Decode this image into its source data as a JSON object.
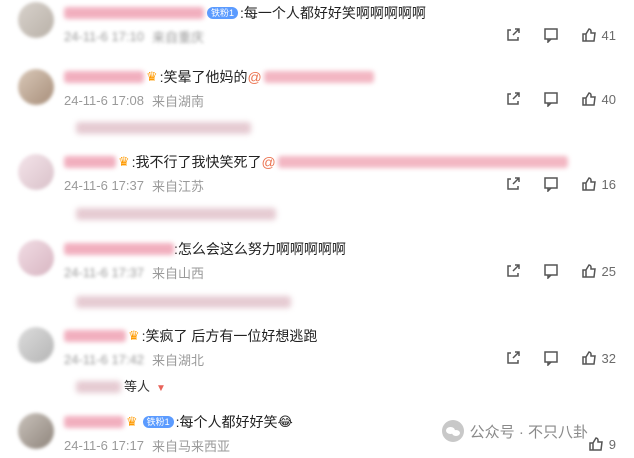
{
  "comments": [
    {
      "text": ":每一个人都好好笑啊啊啊啊啊",
      "badge": "铁粉1",
      "time": "24-11-6 17:10",
      "location": "来自重庆",
      "likes": "41"
    },
    {
      "text": ":笑晕了他妈的",
      "mention": "@",
      "time": "24-11-6 17:08",
      "location": "来自湖南",
      "likes": "40"
    },
    {
      "text": ":我不行了我快笑死了",
      "mention": "@",
      "time": "24-11-6 17:37",
      "location": "来自江苏",
      "likes": "16"
    },
    {
      "text": ":怎么会这么努力啊啊啊啊啊",
      "time": "24-11-6 17:37",
      "location": "来自山西",
      "likes": "25"
    },
    {
      "text": ":笑疯了 后方有一位好想逃跑",
      "time": "24-11-6 17:42",
      "location": "来自湖北",
      "likes": "32",
      "reply_suffix": "等人"
    },
    {
      "text": ":每个人都好好笑",
      "emoji": "😂",
      "badge": "铁粉1",
      "time": "24-11-6 17:17",
      "location": "来自马来西亚",
      "likes": "9"
    }
  ],
  "watermark": {
    "text": "公众号 · 不只八卦"
  },
  "icons": {
    "share": "share-icon",
    "comment": "comment-icon",
    "like": "thumbs-up-icon",
    "crown": "crown-icon"
  }
}
